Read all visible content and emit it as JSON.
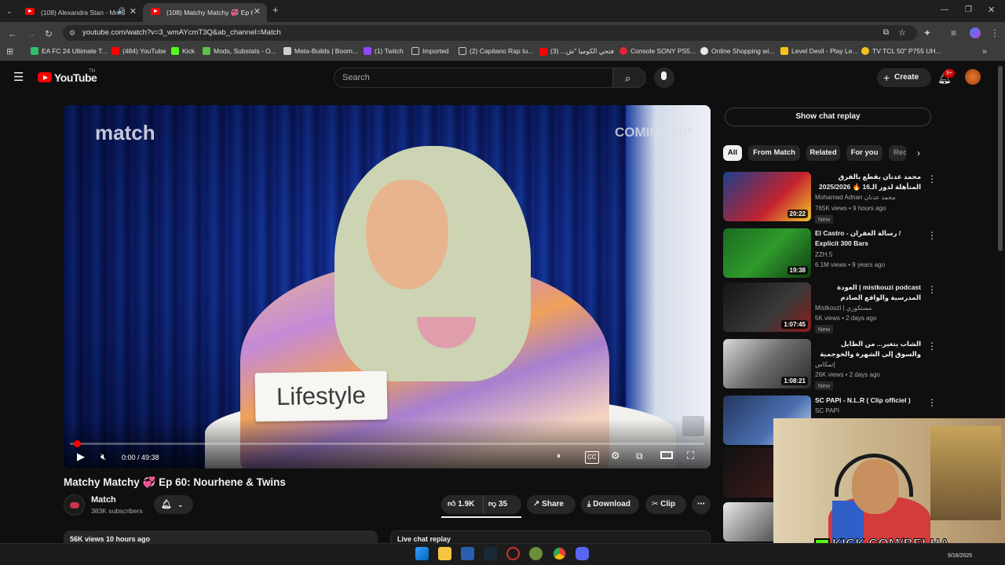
{
  "browser": {
    "tabs": [
      {
        "title": "(108) Alexandra Stan - Mr. S",
        "active": false
      },
      {
        "title": "(108) Matchy Matchy 💞 Ep 60",
        "active": true
      }
    ],
    "url": "youtube.com/watch?v=3_wmAYcmT3Q&ab_channel=Match",
    "bookmarks": [
      {
        "label": "EA FC 24 Ultimate T...",
        "icon": "ea-icon",
        "color": "#2fbf6a"
      },
      {
        "label": "(484) YouTube",
        "icon": "youtube-icon",
        "color": "#ff0000"
      },
      {
        "label": "Kick",
        "icon": "kick-icon",
        "color": "#53fc18"
      },
      {
        "label": "Mods, Substats - O...",
        "icon": "mods-icon",
        "color": "#5cc04a"
      },
      {
        "label": "Meta-Builds | Boom...",
        "icon": "doc-icon",
        "color": "#cfcfcf"
      },
      {
        "label": "(1) Twitch",
        "icon": "twitch-icon",
        "color": "#9146ff"
      },
      {
        "label": "Imported",
        "icon": "folder-icon",
        "color": "#c7c7c7"
      },
      {
        "label": "(2) Capitano Rap tu...",
        "icon": "folder-icon",
        "color": "#c7c7c7"
      },
      {
        "label": "فتحي الكوميا \"ش... (3)",
        "icon": "youtube-icon",
        "color": "#ff0000"
      },
      {
        "label": "Console SONY PS5...",
        "icon": "heart-icon",
        "color": "#e0243a"
      },
      {
        "label": "Online Shopping wi...",
        "icon": "shop-icon",
        "color": "#e8e8e8"
      },
      {
        "label": "Level Devil - Play Le...",
        "icon": "game-icon",
        "color": "#f4c21b"
      },
      {
        "label": "TV TCL 50\" P755 UH...",
        "icon": "tv-icon",
        "color": "#f4c21b"
      }
    ]
  },
  "youtube": {
    "logo_text": "YouTube",
    "logo_sup": "TN",
    "search_placeholder": "Search",
    "create_label": "Create",
    "notif_badge": "9+"
  },
  "video": {
    "overlay_brand": "match",
    "coming_up": "COMING UP",
    "card_text": "Lifestyle",
    "time": "0:00 / 49:38",
    "progress_fraction": 0.0,
    "title": "Matchy Matchy 💞 Ep 60: Nourhene & Twins",
    "channel": "Match",
    "subscribers": "383K subscribers",
    "likes": "1.9K",
    "dislikes": "35",
    "share_label": "Share",
    "download_label": "Download",
    "clip_label": "Clip",
    "views_line": "56K views  10 hours ago",
    "live_chat_label": "Live chat replay"
  },
  "sidebar": {
    "show_chat": "Show chat replay",
    "chips": [
      "All",
      "From Match",
      "Related",
      "For you",
      "Rec"
    ],
    "recommendations": [
      {
        "title": "محمد عدنان يقطع بالفرق المتأهلة لدور الـ16 🔥 2025/2026 لدوري الأبطال",
        "channel": "Mohamad Adnan محمد عدنان",
        "meta": "765K views • 9 hours ago",
        "duration": "20:22",
        "badge": "New",
        "thumb_color": "#1d3f8a"
      },
      {
        "title": "El Castro - رسالة الغفران / Explicit 300 Bars",
        "channel": "ZZH.5",
        "meta": "6.1M views • 9 years ago",
        "duration": "19:38",
        "badge": "",
        "thumb_color": "#1a6b1f"
      },
      {
        "title": "mistkouzi podcast | العودة المدرسية والواقع الصادم للتلامذة في تونس",
        "channel": "Mistkouzi | مستكوزي",
        "meta": "5K views • 2 days ago",
        "duration": "1:07:45",
        "badge": "New",
        "thumb_color": "#2a2a2a"
      },
      {
        "title": "الشاب يتغير... من الطايل والسوق إلى الشهرة والخوجمية مرورا بالمخدرات والسجن",
        "channel": "إتمكاس",
        "meta": "26K views • 2 days ago",
        "duration": "1:08:21",
        "badge": "New",
        "thumb_color": "#6b6b6b"
      },
      {
        "title": "SC PAPI - N.L.R ( Clip officiel )",
        "channel": "SC PAPI",
        "meta": "",
        "duration": "",
        "badge": "",
        "thumb_color": "#24365e"
      }
    ]
  },
  "stream": {
    "kick_text": "KICK.COM/BELHA"
  },
  "taskbar": {
    "date": "9/16/2025"
  }
}
